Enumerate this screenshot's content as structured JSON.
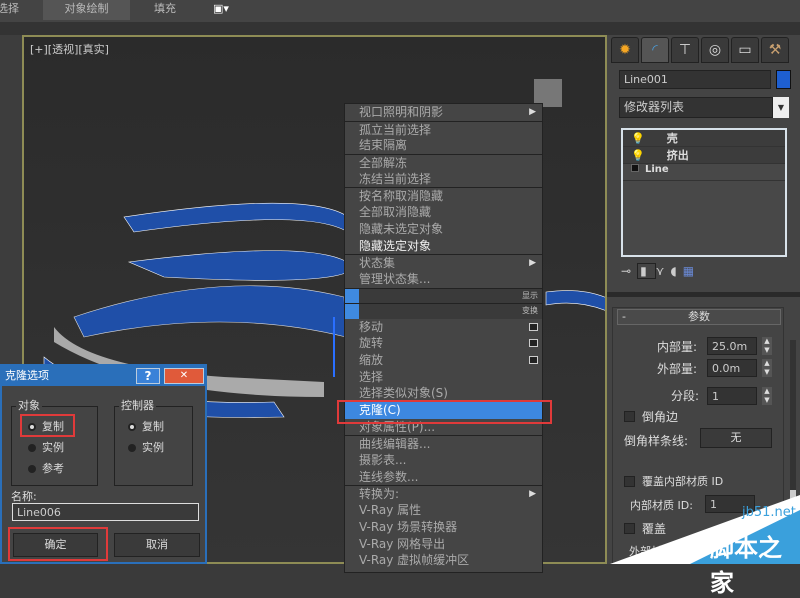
{
  "toolbar": {
    "tabs": [
      "选择",
      "对象绘制",
      "填充"
    ]
  },
  "viewport": {
    "label": "[+][透视][真实]"
  },
  "menu": {
    "items": [
      {
        "label": "视口照明和阴影",
        "submenu": true
      },
      {
        "label": "孤立当前选择",
        "sep": true
      },
      {
        "label": "结束隔离"
      },
      {
        "label": "全部解冻",
        "sep": true
      },
      {
        "label": "冻结当前选择"
      },
      {
        "label": "按名称取消隐藏",
        "sep": true
      },
      {
        "label": "全部取消隐藏"
      },
      {
        "label": "隐藏未选定对象"
      },
      {
        "label": "隐藏选定对象",
        "bright": true
      },
      {
        "label": "状态集",
        "submenu": true,
        "sep": true
      },
      {
        "label": "管理状态集..."
      }
    ],
    "headers": [
      "显示",
      "变换"
    ],
    "items2": [
      {
        "label": "移动",
        "box": true
      },
      {
        "label": "旋转",
        "box": true
      },
      {
        "label": "缩放",
        "box": true
      },
      {
        "label": "选择"
      },
      {
        "label": "选择类似对象(S)"
      },
      {
        "label": "克隆(C)",
        "highlight": true
      },
      {
        "label": "对象属性(P)..."
      },
      {
        "label": "曲线编辑器...",
        "sep": true
      },
      {
        "label": "摄影表..."
      },
      {
        "label": "连线参数..."
      },
      {
        "label": "转换为:",
        "submenu": true,
        "sep": true
      },
      {
        "label": "V-Ray 属性"
      },
      {
        "label": "V-Ray 场景转换器"
      },
      {
        "label": "V-Ray 网格导出"
      },
      {
        "label": "V-Ray 虚拟帧缓冲区"
      }
    ]
  },
  "panel": {
    "object_name": "Line001",
    "object_color": "#1e5fd0",
    "modifier_list": "修改器列表",
    "stack": [
      "壳",
      "挤出",
      "Line"
    ],
    "rollout_title": "参数",
    "inner_label": "内部量:",
    "inner_value": "25.0m",
    "outer_label": "外部量:",
    "outer_value": "0.0m",
    "segments_label": "分段:",
    "segments_value": "1",
    "bevel_edges": "倒角边",
    "bevel_spline_label": "倒角样条线:",
    "bevel_spline_value": "无",
    "override_inner": "覆盖内部材质 ID",
    "inner_mat_label": "内部材质 ID:",
    "inner_mat_value": "1",
    "override_outer": "覆盖",
    "outer_mat_label": "外部材"
  },
  "dialog": {
    "title": "克隆选项",
    "help": "?",
    "close": "✕",
    "object_group": "对象",
    "object_options": [
      "复制",
      "实例",
      "参考"
    ],
    "controller_group": "控制器",
    "controller_options": [
      "复制",
      "实例"
    ],
    "name_label": "名称:",
    "name_value": "Line006",
    "ok": "确定",
    "cancel": "取消"
  },
  "watermark": {
    "site": "jb51.net",
    "name": "脚本之家"
  }
}
